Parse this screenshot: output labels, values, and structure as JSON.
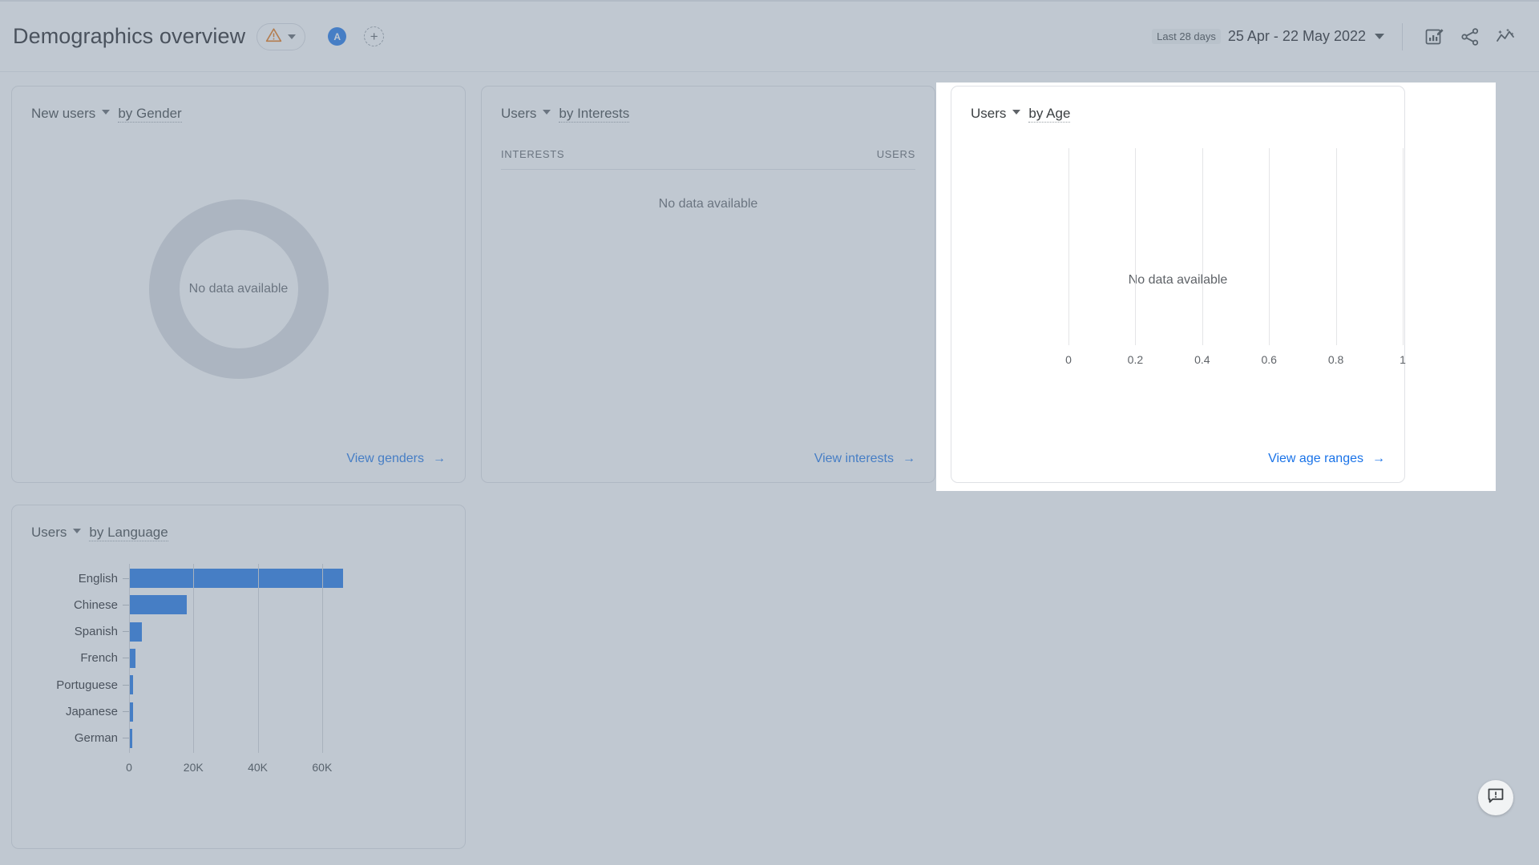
{
  "header": {
    "title": "Demographics overview",
    "warning_icon": "warning-triangle-icon",
    "warning_caret_icon": "chevron-down-icon",
    "avatar_initial": "A",
    "add_label": "+",
    "date_badge": "Last 28 days",
    "date_range": "25 Apr - 22 May 2022",
    "date_caret_icon": "chevron-down-icon",
    "icons": [
      {
        "name": "edit-chart-icon"
      },
      {
        "name": "share-icon"
      },
      {
        "name": "insights-icon"
      }
    ]
  },
  "cards": {
    "gender": {
      "metric": "New users",
      "dimension": "by Gender",
      "empty_text": "No data available",
      "link_label": "View genders",
      "link_arrow": "→"
    },
    "interests": {
      "metric": "Users",
      "dimension": "by Interests",
      "columns": [
        "INTERESTS",
        "USERS"
      ],
      "empty_text": "No data available",
      "link_label": "View interests",
      "link_arrow": "→"
    },
    "age": {
      "metric": "Users",
      "dimension": "by Age",
      "empty_text": "No data available",
      "link_label": "View age ranges",
      "link_arrow": "→"
    },
    "language": {
      "metric": "Users",
      "dimension": "by Language",
      "link_label": "",
      "link_arrow": ""
    }
  },
  "feedback": {
    "icon": "feedback-icon"
  },
  "colors": {
    "accent_blue": "#1a73e8",
    "bar_blue": "#1a73e8",
    "warning_orange": "#e8710a",
    "text_primary": "#202124",
    "text_secondary": "#5f6368",
    "card_border": "#dfe1e5",
    "dim_veil": "#7a8a9e"
  },
  "chart_data": [
    {
      "type": "bar",
      "orientation": "horizontal",
      "title": "Users by Language",
      "xlabel": "",
      "ylabel": "",
      "categories": [
        "English",
        "Chinese",
        "Spanish",
        "French",
        "Portuguese",
        "Japanese",
        "German"
      ],
      "values": [
        66600,
        18000,
        4000,
        1900,
        1200,
        1150,
        1100
      ],
      "xticks": [
        0,
        20000,
        40000,
        60000
      ],
      "xticklabels": [
        "0",
        "20K",
        "40K",
        "60K"
      ],
      "xlim": [
        0,
        72000
      ],
      "grid": true,
      "legend": false,
      "series_color": "#1a73e8"
    },
    {
      "type": "bar",
      "orientation": "horizontal",
      "title": "Users by Age",
      "categories": [],
      "values": [],
      "xticks": [
        0,
        0.2,
        0.4,
        0.6,
        0.8,
        1
      ],
      "xticklabels": [
        "0",
        "0.2",
        "0.4",
        "0.6",
        "0.8",
        "1"
      ],
      "xlim": [
        0,
        1
      ],
      "grid": true,
      "legend": false,
      "annotation": "No data available"
    },
    {
      "type": "pie",
      "variant": "donut",
      "title": "New users by Gender",
      "labels": [],
      "values": [],
      "annotation": "No data available"
    },
    {
      "type": "table",
      "title": "Users by Interests",
      "columns": [
        "INTERESTS",
        "USERS"
      ],
      "rows": [],
      "annotation": "No data available"
    }
  ]
}
